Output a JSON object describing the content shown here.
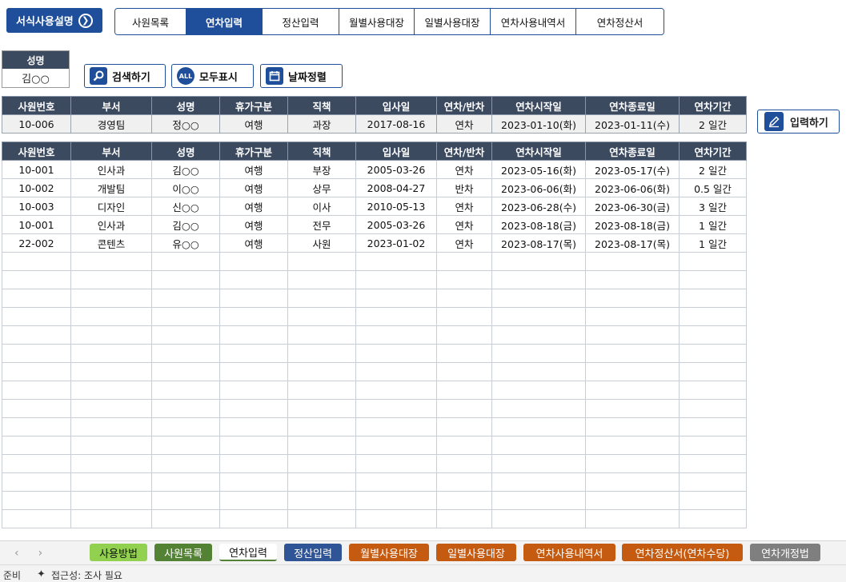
{
  "guide_button": {
    "label": "서식사용설명",
    "icon": "arrow-right-circle-icon"
  },
  "nav_tabs": [
    {
      "label": "사원목록",
      "active": false
    },
    {
      "label": "연차입력",
      "active": true
    },
    {
      "label": "정산입력",
      "active": false
    },
    {
      "label": "월별사용대장",
      "active": false
    },
    {
      "label": "일별사용대장",
      "active": false
    },
    {
      "label": "연차사용내역서",
      "active": false
    },
    {
      "label": "연차정산서",
      "active": false
    }
  ],
  "name_box": {
    "header": "성명",
    "value": "김○○"
  },
  "actions": {
    "search": {
      "label": "검색하기",
      "icon": "search-icon"
    },
    "show_all": {
      "label": "모두표시",
      "icon": "all-icon",
      "icon_text": "ALL"
    },
    "sort_date": {
      "label": "날짜정렬",
      "icon": "calendar-icon"
    }
  },
  "columns": [
    "사원번호",
    "부서",
    "성명",
    "휴가구분",
    "직책",
    "입사일",
    "연차/반차",
    "연차시작일",
    "연차종료일",
    "연차기간"
  ],
  "input_row": [
    "10-006",
    "경영팀",
    "정○○",
    "여행",
    "과장",
    "2017-08-16",
    "연차",
    "2023-01-10(화)",
    "2023-01-11(수)",
    "2 일간"
  ],
  "write_button": {
    "label": "입력하기",
    "icon": "pencil-icon"
  },
  "records": [
    [
      "10-001",
      "인사과",
      "김○○",
      "여행",
      "부장",
      "2005-03-26",
      "연차",
      "2023-05-16(화)",
      "2023-05-17(수)",
      "2 일간"
    ],
    [
      "10-002",
      "개발팀",
      "이○○",
      "여행",
      "상무",
      "2008-04-27",
      "반차",
      "2023-06-06(화)",
      "2023-06-06(화)",
      "0.5 일간"
    ],
    [
      "10-003",
      "디자인",
      "신○○",
      "여행",
      "이사",
      "2010-05-13",
      "연차",
      "2023-06-28(수)",
      "2023-06-30(금)",
      "3 일간"
    ],
    [
      "10-001",
      "인사과",
      "김○○",
      "여행",
      "전무",
      "2005-03-26",
      "연차",
      "2023-08-18(금)",
      "2023-08-18(금)",
      "1 일간"
    ],
    [
      "22-002",
      "콘텐츠",
      "유○○",
      "여행",
      "사원",
      "2023-01-02",
      "연차",
      "2023-08-17(목)",
      "2023-08-17(목)",
      "1 일간"
    ]
  ],
  "sheet_tabs": [
    {
      "label": "사용방법",
      "color": "#92d050"
    },
    {
      "label": "사원목록",
      "color": "#548235"
    },
    {
      "label": "연차입력",
      "color": "#ffffff",
      "active": true
    },
    {
      "label": "정산입력",
      "color": "#2f5597"
    },
    {
      "label": "월별사용대장",
      "color": "#c55a11"
    },
    {
      "label": "일별사용대장",
      "color": "#c55a11"
    },
    {
      "label": "연차사용내역서",
      "color": "#c55a11"
    },
    {
      "label": "연차정산서(연차수당)",
      "color": "#c55a11"
    },
    {
      "label": "연차개정법",
      "color": "#7f7f7f"
    }
  ],
  "status": {
    "ready": "준비",
    "accessibility": "접근성: 조사 필요"
  }
}
